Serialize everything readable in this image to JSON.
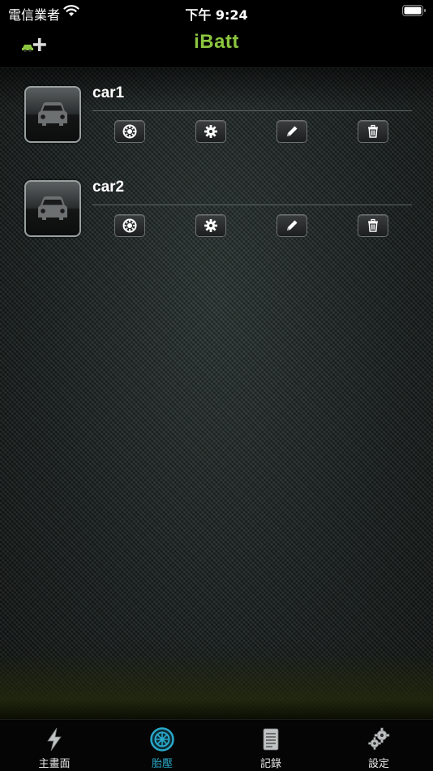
{
  "status_bar": {
    "carrier": "電信業者",
    "time": "下午 9:24"
  },
  "nav": {
    "title": "iBatt",
    "add_car_icon": "add-car-icon"
  },
  "cars": [
    {
      "name": "car1",
      "actions": [
        "tire-gauge-icon",
        "gear-icon",
        "pencil-icon",
        "trash-icon"
      ]
    },
    {
      "name": "car2",
      "actions": [
        "tire-gauge-icon",
        "gear-icon",
        "pencil-icon",
        "trash-icon"
      ]
    }
  ],
  "tabs": [
    {
      "label": "主畫面",
      "icon": "lightning-icon",
      "active": false
    },
    {
      "label": "胎壓",
      "icon": "tire-icon",
      "active": true
    },
    {
      "label": "記錄",
      "icon": "document-icon",
      "active": false
    },
    {
      "label": "設定",
      "icon": "gears-icon",
      "active": false
    }
  ],
  "colors": {
    "title_green": "#8bc53f",
    "active_tab": "#29a8c9"
  }
}
